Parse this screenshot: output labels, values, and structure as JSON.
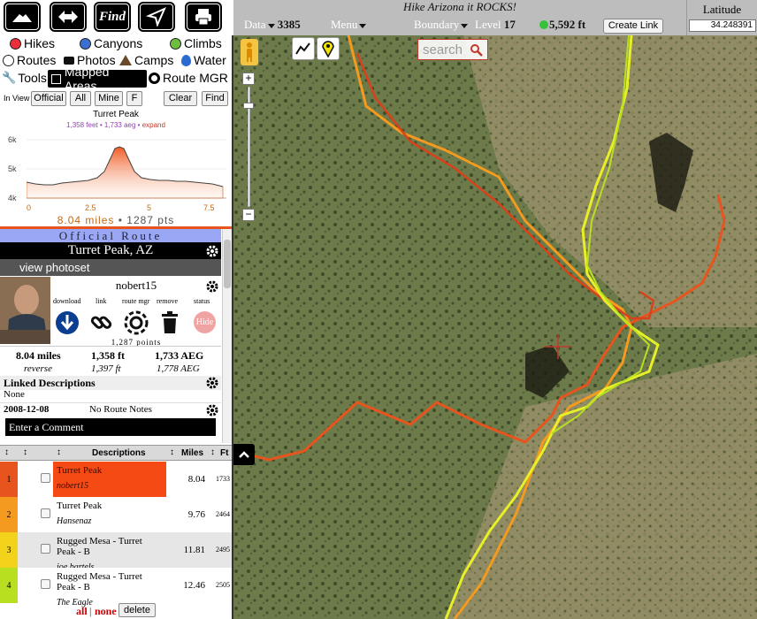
{
  "toolbar": {
    "find_label": "Find"
  },
  "header": {
    "motto": "Hike Arizona it ROCKS!",
    "data_label": "Data",
    "data_value": "3385",
    "menu_label": "Menu",
    "boundary_label": "Boundary",
    "level_label": "Level",
    "level_value": "17",
    "elevation": "5,592 ft",
    "create_link": "Create Link"
  },
  "latitude": {
    "label": "Latitude",
    "value": "34.248391"
  },
  "legend": {
    "hikes": "Hikes",
    "canyons": "Canyons",
    "climbs": "Climbs",
    "routes": "Routes",
    "photos": "Photos",
    "camps": "Camps",
    "water": "Water",
    "tools": "Tools",
    "mapped_areas": "Mapped Areas",
    "route_mgr": "Route MGR"
  },
  "colors": {
    "hikes": "#e8303a",
    "canyons": "#3b6fd1",
    "climbs": "#6cbf3c",
    "official": "#9aa7f5",
    "route": "#e8541d"
  },
  "filter": {
    "in_view": "In View",
    "official": "Official",
    "all": "All",
    "mine": "Mine",
    "f": "F",
    "clear": "Clear",
    "find": "Find"
  },
  "profile": {
    "title": "Turret Peak",
    "subtitle_stats": "1,358 feet • 1,733 aeg",
    "expand": "expand",
    "y_ticks": [
      "6k",
      "5k",
      "4k"
    ],
    "x_ticks": [
      "0",
      "2.5",
      "5",
      "7.5"
    ],
    "summary_miles": "8.04 miles",
    "summary_pts": "1287 pts"
  },
  "route": {
    "official_banner": "Official Route",
    "title": "Turret Peak, AZ",
    "view_photoset": "view photoset",
    "user": "nobert15",
    "actions": {
      "download": "download",
      "link": "link",
      "route_mgr": "route mgr",
      "remove": "remove",
      "status": "status",
      "hide": "Hide"
    },
    "points": "1,287 points",
    "miles": "8.04 miles",
    "elev": "1,358 ft",
    "aeg": "1,733 AEG",
    "reverse_label": "reverse",
    "reverse_elev": "1,397 ft",
    "reverse_aeg": "1,778 AEG",
    "linked_heading": "Linked Descriptions",
    "linked_value": "None",
    "date": "2008-12-08",
    "notes": "No Route Notes",
    "comment_placeholder": "Enter a Comment"
  },
  "table": {
    "headers": {
      "descriptions": "Descriptions",
      "miles": "Miles",
      "ft": "Ft"
    },
    "rows": [
      {
        "num": "1",
        "title": "Turret Peak",
        "user": "nobert15",
        "miles": "8.04",
        "ft": "1733",
        "color": "#e8541d"
      },
      {
        "num": "2",
        "title": "Turret Peak",
        "user": "Hansenaz",
        "miles": "9.76",
        "ft": "2464",
        "color": "#f39a1f"
      },
      {
        "num": "3",
        "title": "Rugged Mesa - Turret Peak - B",
        "user": "joe bartels",
        "miles": "11.81",
        "ft": "2495",
        "color": "#f2d21a"
      },
      {
        "num": "4",
        "title": "Rugged Mesa - Turret Peak - B",
        "user": "The Eagle",
        "miles": "12.46",
        "ft": "2505",
        "color": "#b8e020"
      }
    ]
  },
  "bottom": {
    "all": "all",
    "sep": "|",
    "none": "none",
    "delete": "delete"
  },
  "map": {
    "search_placeholder": "search"
  }
}
